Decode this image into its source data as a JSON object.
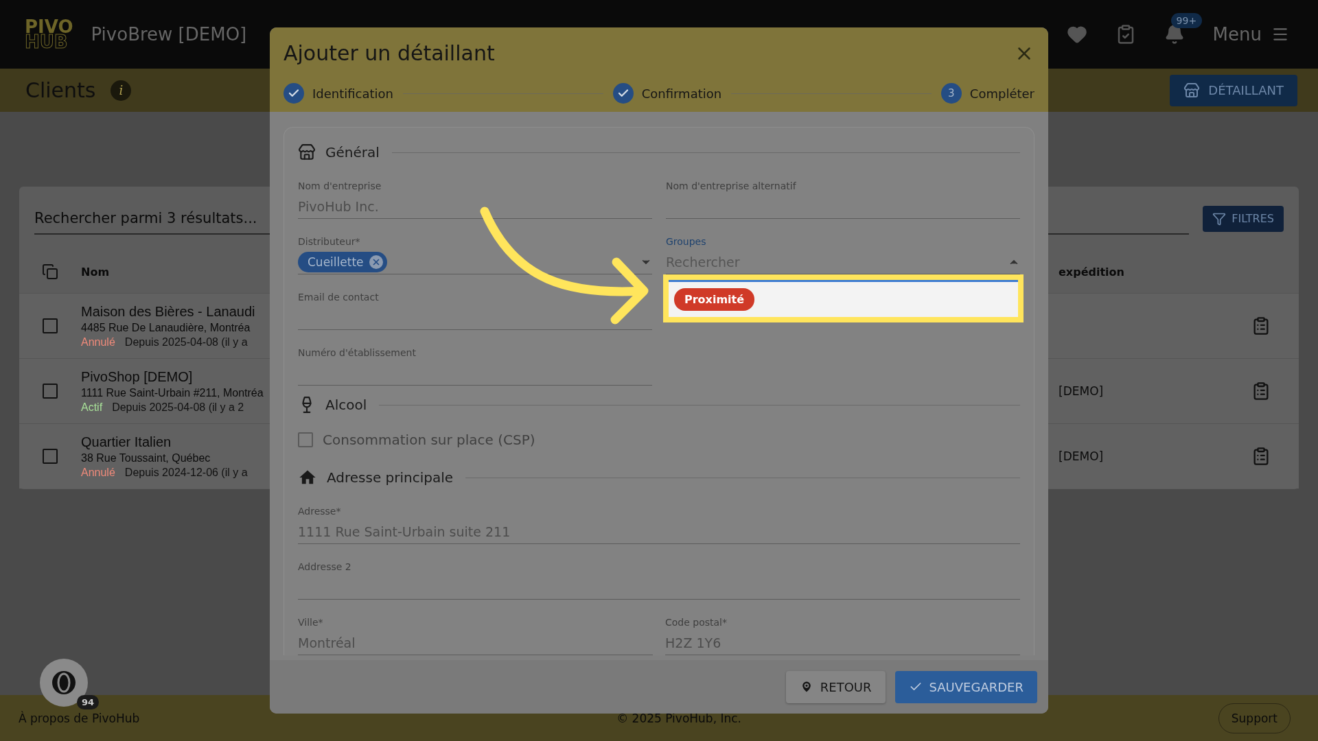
{
  "app_bar": {
    "logo_top": "PIVO",
    "logo_bottom": "HUB",
    "title": "PivoBrew [DEMO]",
    "notification_badge": "99+",
    "menu_label": "Menu"
  },
  "page_header": {
    "title": "Clients",
    "info_icon": "i",
    "add_button": "DÉTAILLANT"
  },
  "list": {
    "search_placeholder": "Rechercher parmi 3 résultats...",
    "filter_button": "FILTRES",
    "columns": [
      "Nom",
      "expédition"
    ],
    "rows": [
      {
        "name": "Maison des Bières - Lanaudi",
        "address": "4485 Rue De Lanaudière, Montréa",
        "status": "Annulé",
        "color": "#f08a7a",
        "since": "Depuis 2025-04-08 (il y a",
        "column_2": null,
        "checked": false
      },
      {
        "name": "PivoShop [DEMO]",
        "address": "1111 Rue Saint-Urbain #211, Montréa",
        "status": "Actif",
        "color": "#a8e098",
        "since": "Depuis 2025-04-08 (il y a 2",
        "column_2": "[DEMO]",
        "checked": false
      },
      {
        "name": "Quartier Italien",
        "address": "38 Rue Toussaint, Québec",
        "status": "Annulé",
        "color": "#f08a7a",
        "since": "Depuis 2024-12-06 (il y a",
        "column_2": "[DEMO]",
        "checked": false
      }
    ]
  },
  "dialog": {
    "title": "Ajouter un détaillant",
    "steps": [
      {
        "label": "Identification",
        "completed": true
      },
      {
        "label": "Confirmation",
        "completed": true
      },
      {
        "label": "Compléter",
        "completed": false,
        "number": "3"
      }
    ],
    "general": {
      "title": "Général",
      "left_fields": [
        {
          "kind": "text",
          "label": "Nom d'entreprise",
          "value": "PivoHub Inc."
        },
        {
          "kind": "select",
          "label": "Distributeur*",
          "chips": [
            "Cueillette"
          ]
        },
        {
          "kind": "text",
          "label": "Email de contact"
        },
        {
          "kind": "text",
          "label": "Numéro d'établissement"
        }
      ],
      "right_fields": [
        {
          "kind": "text",
          "label": "Nom d'entreprise alternatif"
        },
        {
          "kind": "select",
          "label": "Groupes",
          "placeholder": "Rechercher",
          "expanded": true,
          "options": [
            {
              "label": "Proximité",
              "color": "#d03a28"
            }
          ]
        }
      ]
    },
    "alcohol": {
      "title": "Alcool",
      "options": [
        {
          "label": "Consommation sur place (CSP)",
          "checked": false
        }
      ]
    },
    "address": {
      "title": "Adresse principale",
      "fields": [
        {
          "kind": "full",
          "label": "Adresse*",
          "value": "1111 Rue Saint-Urbain suite 211"
        },
        {
          "kind": "full",
          "label": "Addresse 2"
        },
        {
          "kind": "half",
          "label": "Ville*",
          "value": "Montréal"
        },
        {
          "kind": "half",
          "label": "Code postal*",
          "value": "H2Z 1Y6"
        }
      ]
    },
    "back_button": "RETOUR",
    "save_button": "SAUVEGARDER"
  },
  "footer": {
    "about": "À propos de PivoHub",
    "copyright": "© 2025 PivoHub, Inc.",
    "support": "Support"
  },
  "floating_widget": {
    "badge": "94"
  }
}
